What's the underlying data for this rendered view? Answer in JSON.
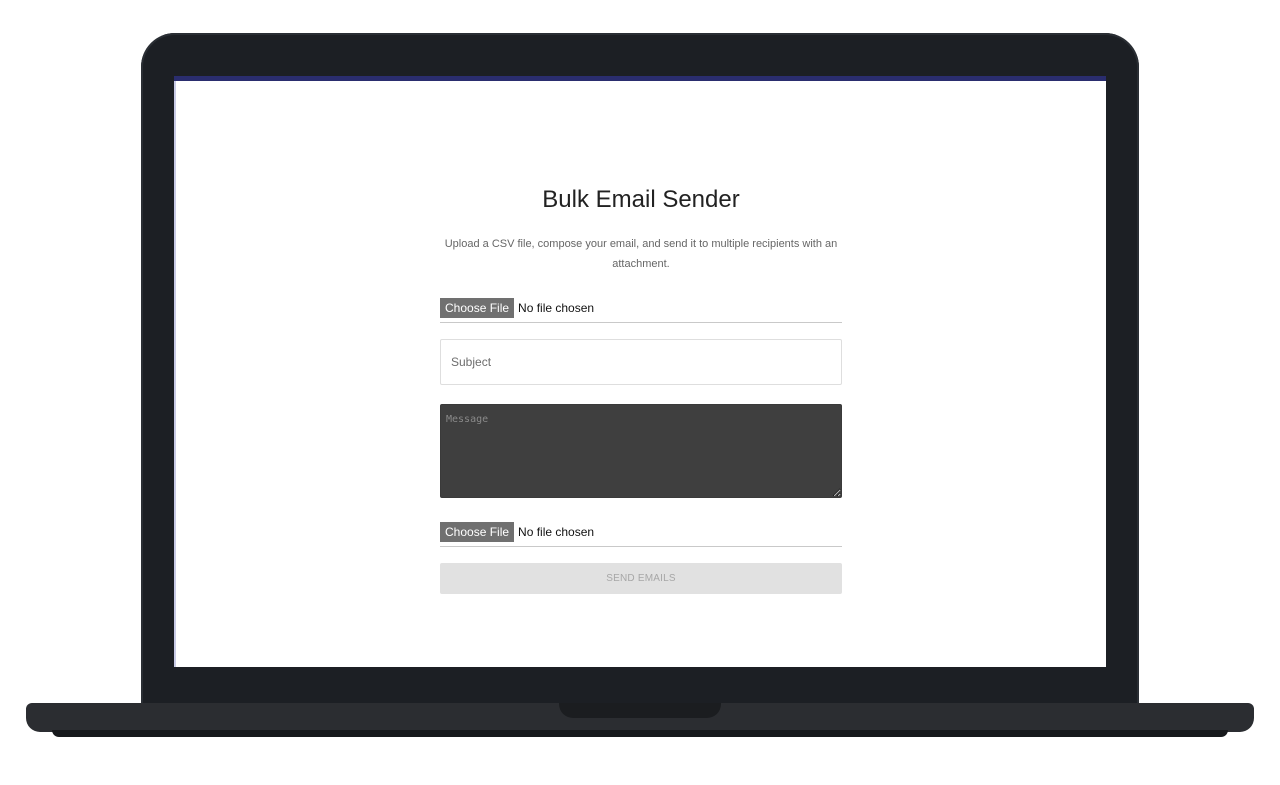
{
  "app": {
    "title": "Bulk Email Sender",
    "subtitle": "Upload a CSV file, compose your email, and send it to multiple recipients with an attachment."
  },
  "csv_upload": {
    "button_label": "Choose File",
    "status_text": "No file chosen"
  },
  "subject": {
    "placeholder": "Subject",
    "value": ""
  },
  "message": {
    "placeholder": "Message",
    "value": ""
  },
  "attachment_upload": {
    "button_label": "Choose File",
    "status_text": "No file chosen"
  },
  "send_button": {
    "label": "SEND EMAILS",
    "state": "disabled"
  },
  "colors": {
    "bezel": "#1c1f24",
    "message_bg": "#3f3f3f",
    "choose_file_bg": "#707070",
    "send_button_bg": "#e1e1e1"
  }
}
